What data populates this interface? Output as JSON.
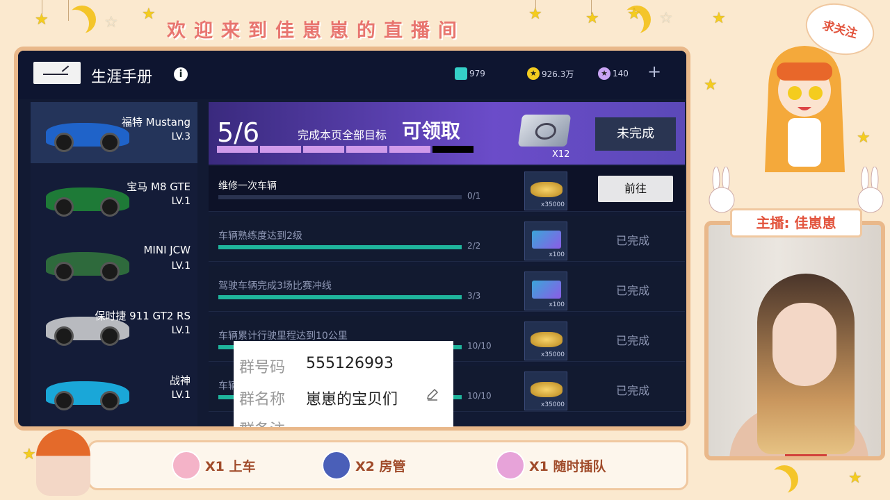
{
  "overlay": {
    "banner": "欢迎来到佳崽崽的直播间",
    "follow_bubble": "求关注",
    "streamer_label": "主播: 佳崽崽",
    "perks": [
      {
        "label": "X1 上车",
        "avatar": "cake-avatar",
        "color": "#f4b3c8"
      },
      {
        "label": "X2 房管",
        "avatar": "fox-avatar",
        "color": "#4a5fb8"
      },
      {
        "label": "X1 随时插队",
        "avatar": "pink-girl-avatar",
        "color": "#e7a3d9"
      }
    ]
  },
  "game": {
    "title": "生涯手册",
    "info_icon": "i",
    "currencies": [
      {
        "name": "tickets",
        "value": "979",
        "color": "#35d0c8"
      },
      {
        "name": "coins",
        "value": "926.3万",
        "color": "#f4cc1f"
      },
      {
        "name": "gems",
        "value": "140",
        "color": "#c9a4f4"
      }
    ],
    "plus": "+",
    "cars": [
      {
        "name": "福特 Mustang",
        "level": "LV.3",
        "color": "#1f63c9",
        "selected": true
      },
      {
        "name": "宝马 M8 GTE",
        "level": "LV.1",
        "color": "#1e7a37",
        "selected": false
      },
      {
        "name": "MINI JCW",
        "level": "LV.1",
        "color": "#2e6a3c",
        "selected": false
      },
      {
        "name": "保时捷 911 GT2 RS",
        "level": "LV.1",
        "color": "#b8babf",
        "selected": false
      },
      {
        "name": "战神",
        "level": "LV.1",
        "color": "#1aa7d8",
        "selected": false
      }
    ],
    "page_progress": {
      "text": "5/6",
      "goal_text": "完成本页全部目标",
      "claim_text": "可领取",
      "done": 5,
      "total": 6
    },
    "page_reward_count": "X12",
    "page_status": "未完成",
    "tasks": [
      {
        "name": "维修一次车辆",
        "count": "0/1",
        "progress": 0.0,
        "reward": "gold",
        "reward_qty": "x35000",
        "status": "前往",
        "action": true
      },
      {
        "name": "车辆熟练度达到2级",
        "count": "2/2",
        "progress": 1.0,
        "reward": "card",
        "reward_qty": "x100",
        "status": "已完成",
        "action": false
      },
      {
        "name": "驾驶车辆完成3场比赛冲线",
        "count": "3/3",
        "progress": 1.0,
        "reward": "card",
        "reward_qty": "x100",
        "status": "已完成",
        "action": false
      },
      {
        "name": "车辆累计行驶里程达到10公里",
        "count": "10/10",
        "progress": 1.0,
        "reward": "gold",
        "reward_qty": "x35000",
        "status": "已完成",
        "action": false
      },
      {
        "name": "车辆",
        "count": "10/10",
        "progress": 1.0,
        "reward": "gold",
        "reward_qty": "x35000",
        "status": "已完成",
        "action": false
      }
    ]
  },
  "group_popup": {
    "number_label": "群号码",
    "number_value": "555126993",
    "name_label": "群名称",
    "name_value": "崽崽的宝贝们",
    "third_label": "群备注"
  }
}
